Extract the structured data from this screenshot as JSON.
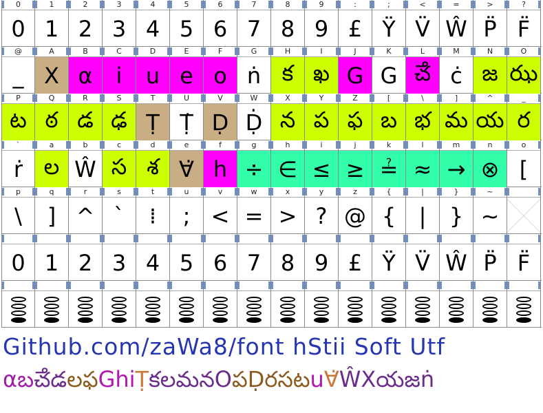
{
  "rows": [
    {
      "cells": [
        {
          "label": "0",
          "glyph": "0"
        },
        {
          "label": "1",
          "glyph": "1"
        },
        {
          "label": "2",
          "glyph": "2"
        },
        {
          "label": "3",
          "glyph": "3"
        },
        {
          "label": "4",
          "glyph": "4"
        },
        {
          "label": "5",
          "glyph": "5"
        },
        {
          "label": "6",
          "glyph": "6"
        },
        {
          "label": "7",
          "glyph": "7"
        },
        {
          "label": "8",
          "glyph": "8"
        },
        {
          "label": "9",
          "glyph": "9"
        },
        {
          "label": ":",
          "glyph": "£"
        },
        {
          "label": ";",
          "glyph": "Ÿ"
        },
        {
          "label": "<",
          "glyph": "V̈"
        },
        {
          "label": "=",
          "glyph": "Ŵ"
        },
        {
          "label": ">",
          "glyph": "P̈"
        },
        {
          "label": "?",
          "glyph": "F̈"
        }
      ]
    },
    {
      "cells": [
        {
          "label": "@",
          "glyph": "_"
        },
        {
          "label": "A",
          "glyph": "X",
          "bg": "#c9ad84"
        },
        {
          "label": "B",
          "glyph": "α",
          "bg": "#ff00ff"
        },
        {
          "label": "C",
          "glyph": "i",
          "bg": "#ff00ff"
        },
        {
          "label": "D",
          "glyph": "u",
          "bg": "#ff00ff"
        },
        {
          "label": "E",
          "glyph": "e",
          "bg": "#ff00ff"
        },
        {
          "label": "F",
          "glyph": "o",
          "bg": "#ff00ff"
        },
        {
          "label": "G",
          "glyph": "ṅ"
        },
        {
          "label": "H",
          "glyph": "క",
          "bg": "#ccff00"
        },
        {
          "label": "I",
          "glyph": "ఖ",
          "bg": "#ccff00"
        },
        {
          "label": "J",
          "glyph": "G",
          "bg": "#ff00ff"
        },
        {
          "label": "K",
          "glyph": "G"
        },
        {
          "label": "L",
          "glyph": "ౘ",
          "bg": "#ff00ff"
        },
        {
          "label": "M",
          "glyph": "ċ"
        },
        {
          "label": "N",
          "glyph": "జ",
          "bg": "#ccff00"
        },
        {
          "label": "O",
          "glyph": "ఝ",
          "bg": "#ccff00"
        }
      ]
    },
    {
      "cells": [
        {
          "label": "P",
          "glyph": "ట",
          "bg": "#ccff00"
        },
        {
          "label": "Q",
          "glyph": "ఠ",
          "bg": "#ccff00"
        },
        {
          "label": "R",
          "glyph": "డ",
          "bg": "#ccff00"
        },
        {
          "label": "S",
          "glyph": "ఢ",
          "bg": "#ccff00"
        },
        {
          "label": "T",
          "glyph": "Ṭ",
          "bg": "#c9ad84"
        },
        {
          "label": "U",
          "glyph": "Ṭ̇"
        },
        {
          "label": "V",
          "glyph": "Ḍ",
          "bg": "#c9ad84"
        },
        {
          "label": "W",
          "glyph": "Ḍ̇"
        },
        {
          "label": "X",
          "glyph": "న",
          "bg": "#ccff00"
        },
        {
          "label": "Y",
          "glyph": "ప",
          "bg": "#ccff00"
        },
        {
          "label": "Z",
          "glyph": "ఫ",
          "bg": "#ccff00"
        },
        {
          "label": "[",
          "glyph": "బ",
          "bg": "#ccff00"
        },
        {
          "label": "\\",
          "glyph": "భ",
          "bg": "#ccff00"
        },
        {
          "label": "]",
          "glyph": "మ",
          "bg": "#ccff00"
        },
        {
          "label": "^",
          "glyph": "య",
          "bg": "#ccff00"
        },
        {
          "label": "_",
          "glyph": "ర",
          "bg": "#ccff00"
        }
      ]
    },
    {
      "cells": [
        {
          "label": "`",
          "glyph": "ṙ"
        },
        {
          "label": "a",
          "glyph": "ల",
          "bg": "#ccff00"
        },
        {
          "label": "b",
          "glyph": "Ŵ"
        },
        {
          "label": "c",
          "glyph": "స",
          "bg": "#ccff00"
        },
        {
          "label": "d",
          "glyph": "శ",
          "bg": "#ccff00"
        },
        {
          "label": "e",
          "glyph": "∀̇",
          "bg": "#c9ad84"
        },
        {
          "label": "f",
          "glyph": "h",
          "bg": "#ff00ff"
        },
        {
          "label": "g",
          "glyph": "÷",
          "bg": "#33ffaa"
        },
        {
          "label": "h",
          "glyph": "∈",
          "bg": "#33ffaa"
        },
        {
          "label": "i",
          "glyph": "≤",
          "bg": "#33ffaa"
        },
        {
          "label": "j",
          "glyph": "≥",
          "bg": "#33ffaa"
        },
        {
          "label": "k",
          "glyph": "≟",
          "bg": "#33ffaa"
        },
        {
          "label": "l",
          "glyph": "≈",
          "bg": "#33ffaa"
        },
        {
          "label": "m",
          "glyph": "→",
          "bg": "#33ffaa"
        },
        {
          "label": "n",
          "glyph": "⊗",
          "bg": "#33ffaa"
        },
        {
          "label": "o",
          "glyph": "["
        }
      ]
    },
    {
      "cells": [
        {
          "label": "p",
          "glyph": "\\"
        },
        {
          "label": "q",
          "glyph": "]"
        },
        {
          "label": "r",
          "glyph": "^"
        },
        {
          "label": "s",
          "glyph": "`"
        },
        {
          "label": "t",
          "glyph": "⁞"
        },
        {
          "label": "u",
          "glyph": ";"
        },
        {
          "label": "v",
          "glyph": "<"
        },
        {
          "label": "w",
          "glyph": "="
        },
        {
          "label": "x",
          "glyph": ">"
        },
        {
          "label": "y",
          "glyph": "?"
        },
        {
          "label": "z",
          "glyph": "@"
        },
        {
          "label": "{",
          "glyph": "{"
        },
        {
          "label": "|",
          "glyph": "|"
        },
        {
          "label": "}",
          "glyph": "}"
        },
        {
          "label": "~",
          "glyph": "~"
        },
        {
          "label": "",
          "glyph": "",
          "empty": true
        }
      ]
    },
    {
      "cells": [
        {
          "label": "",
          "glyph": "0"
        },
        {
          "label": "",
          "glyph": "1"
        },
        {
          "label": "",
          "glyph": "2"
        },
        {
          "label": "",
          "glyph": "3"
        },
        {
          "label": "",
          "glyph": "4"
        },
        {
          "label": "",
          "glyph": "5"
        },
        {
          "label": "",
          "glyph": "6"
        },
        {
          "label": "",
          "glyph": "7"
        },
        {
          "label": "",
          "glyph": "8"
        },
        {
          "label": "",
          "glyph": "9"
        },
        {
          "label": "",
          "glyph": "£"
        },
        {
          "label": "",
          "glyph": "Ÿ"
        },
        {
          "label": "",
          "glyph": "V̈"
        },
        {
          "label": "",
          "glyph": "Ŵ"
        },
        {
          "label": "",
          "glyph": "P̈"
        },
        {
          "label": "",
          "glyph": "F̈"
        }
      ]
    },
    {
      "cells": [
        {
          "label": "",
          "dots": true
        },
        {
          "label": "",
          "dots": true
        },
        {
          "label": "",
          "dots": true
        },
        {
          "label": "",
          "dots": true
        },
        {
          "label": "",
          "dots": true
        },
        {
          "label": "",
          "dots": true
        },
        {
          "label": "",
          "dots": true
        },
        {
          "label": "",
          "dots": true
        },
        {
          "label": "",
          "dots": true
        },
        {
          "label": "",
          "dots": true
        },
        {
          "label": "",
          "dots": true
        },
        {
          "label": "",
          "dots": true
        },
        {
          "label": "",
          "dots": true
        },
        {
          "label": "",
          "dots": true
        },
        {
          "label": "",
          "dots": true
        },
        {
          "label": "",
          "dots": true
        }
      ]
    }
  ],
  "footer": {
    "line1": "Github.com/zaWa8/font hStii Soft Utf",
    "line2_segments": [
      {
        "text": "αబ",
        "color": "#9c1fa6"
      },
      {
        "text": "ౘడ",
        "color": "#6b2d8a"
      },
      {
        "text": "లఫ",
        "color": "#8a5a1e"
      },
      {
        "text": "Ghi",
        "color": "#b018b0"
      },
      {
        "text": "Ṭ",
        "color": "#c9783a"
      },
      {
        "text": "కలమనO",
        "color": "#6b2d8a"
      },
      {
        "text": "పḌరసట",
        "color": "#8a5a1e"
      },
      {
        "text": "u",
        "color": "#b018b0"
      },
      {
        "text": "∀̇",
        "color": "#c9783a"
      },
      {
        "text": "ŴX",
        "color": "#6b2d8a"
      },
      {
        "text": "యజṅ",
        "color": "#6b2d8a"
      }
    ]
  }
}
